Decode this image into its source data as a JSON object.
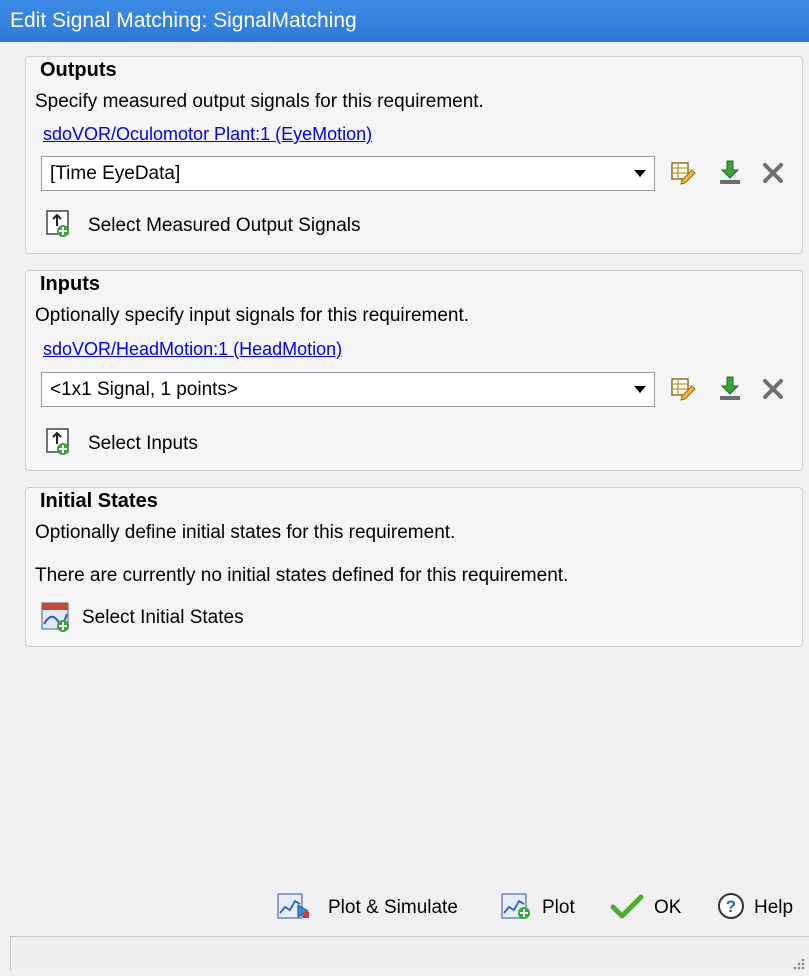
{
  "window": {
    "title": "Edit Signal Matching: SignalMatching"
  },
  "outputs": {
    "heading": "Outputs",
    "description": "Specify measured output signals for this requirement.",
    "signal_link": "sdoVOR/Oculomotor Plant:1 (EyeMotion)",
    "combo_value": "[Time EyeData]",
    "select_button_label": "Select Measured Output Signals"
  },
  "inputs": {
    "heading": "Inputs",
    "description": "Optionally specify input signals for this requirement.",
    "signal_link": "sdoVOR/HeadMotion:1 (HeadMotion)",
    "combo_value": "<1x1 Signal, 1 points>",
    "select_button_label": "Select Inputs"
  },
  "initial_states": {
    "heading": "Initial States",
    "description": "Optionally define initial states for this requirement.",
    "status_text": "There are currently no initial states defined for this requirement.",
    "select_button_label": "Select Initial States"
  },
  "footer": {
    "plot_simulate_label": "Plot & Simulate",
    "plot_label": "Plot",
    "ok_label": "OK",
    "help_label": "Help"
  },
  "icons": {
    "edit": "table-edit-icon",
    "import": "import-arrow-icon",
    "delete": "delete-x-icon",
    "select_signal": "select-signal-icon",
    "select_states": "select-states-icon",
    "plot_simulate": "plot-simulate-icon",
    "plot": "plot-icon",
    "ok": "checkmark-icon",
    "help": "help-icon"
  },
  "colors": {
    "title_bar": "#3c8ae6",
    "link": "#0000ee",
    "panel_bg": "#f5f5f5",
    "window_bg": "#f0f0f0",
    "import_arrow": "#3aa53a",
    "ok_check": "#4caf2a",
    "help_blue": "#2f5fb3"
  }
}
